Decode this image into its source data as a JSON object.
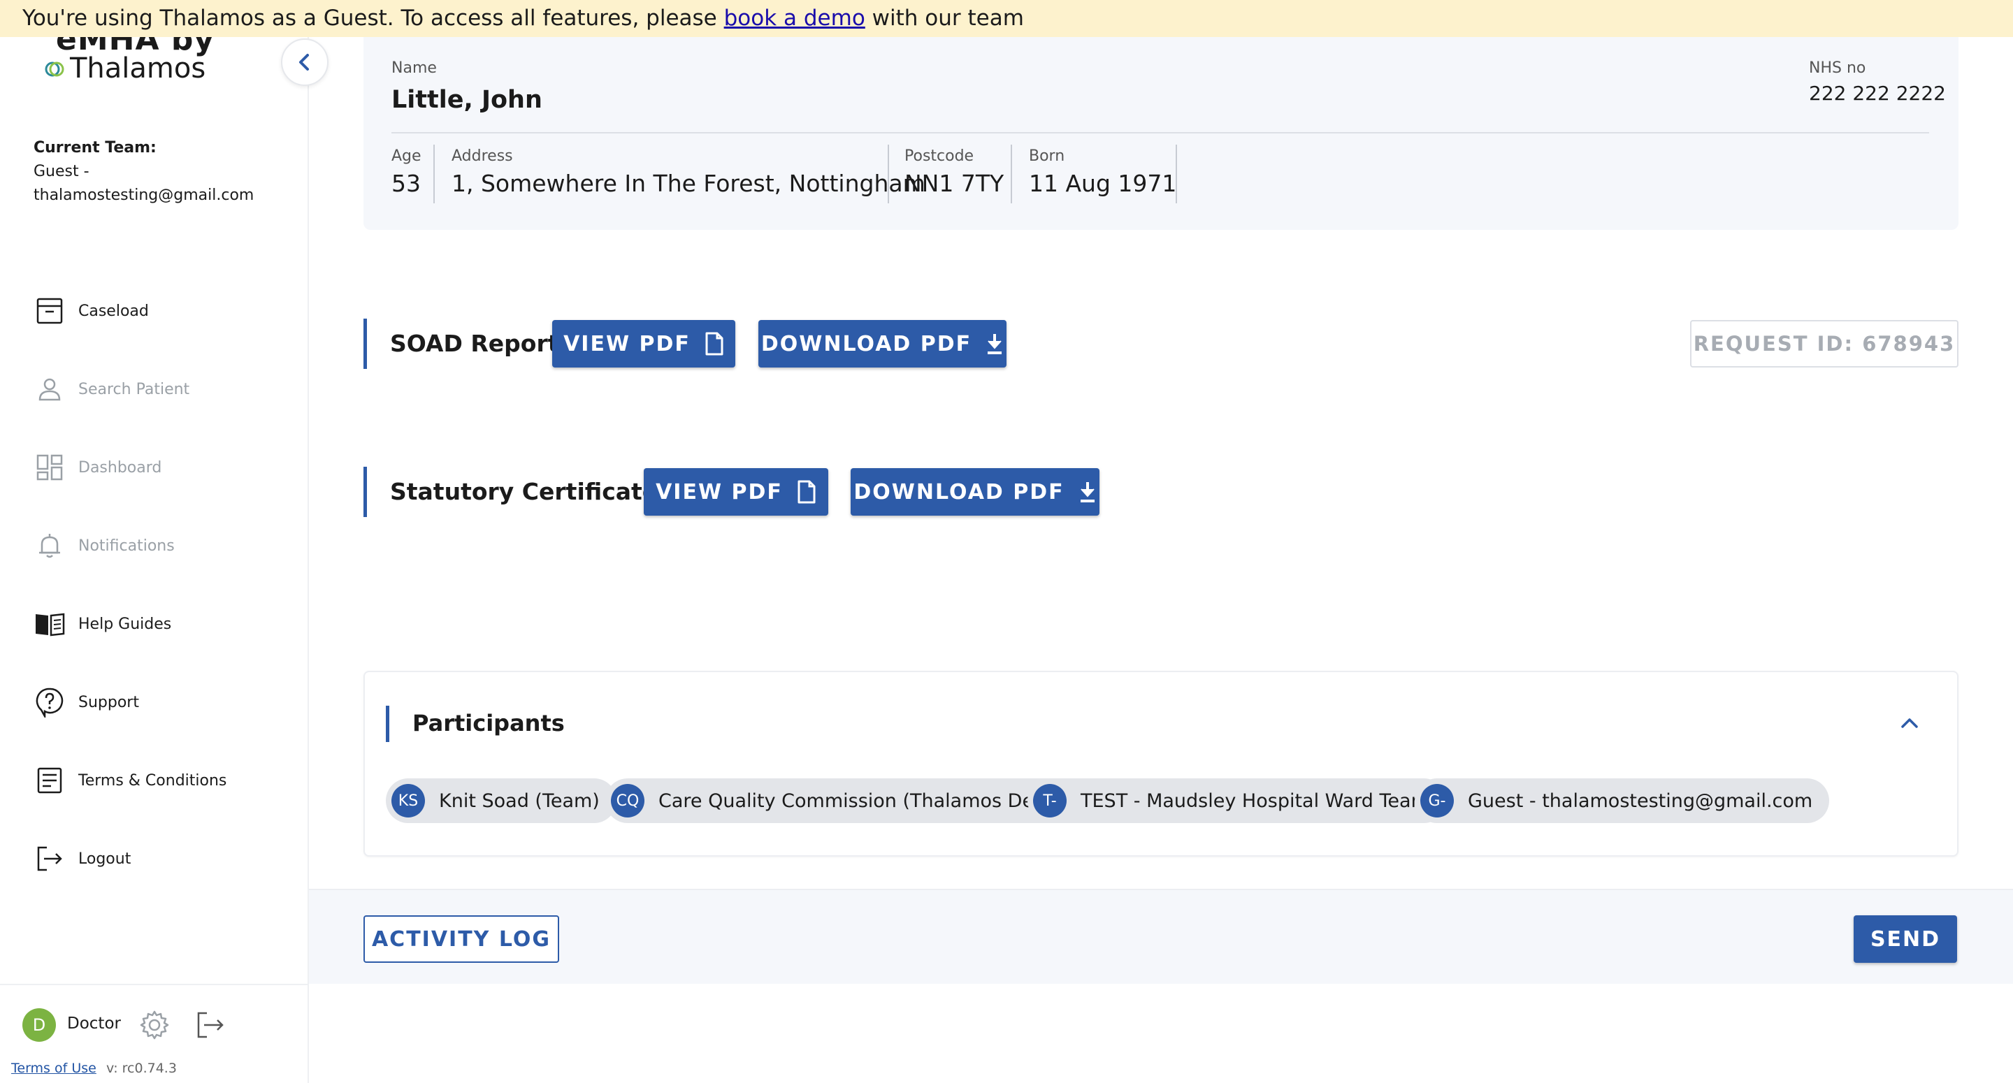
{
  "banner": {
    "text_before": "You're using Thalamos as a Guest. To access all features, please ",
    "link": "book a demo",
    "text_after": " with our team"
  },
  "sidebar": {
    "logo_line1": "eMHA by",
    "logo_line2": "Thalamos",
    "team_label": "Current Team:",
    "team_line1": "Guest -",
    "team_line2": "thalamostesting@gmail.com",
    "items": [
      {
        "label": "Caseload",
        "icon": "archive-box-icon",
        "enabled": true
      },
      {
        "label": "Search Patient",
        "icon": "person-icon",
        "enabled": false
      },
      {
        "label": "Dashboard",
        "icon": "grid-icon",
        "enabled": false
      },
      {
        "label": "Notifications",
        "icon": "bell-icon",
        "enabled": false
      },
      {
        "label": "Help Guides",
        "icon": "open-book-icon",
        "enabled": true
      },
      {
        "label": "Support",
        "icon": "question-bubble-icon",
        "enabled": true
      },
      {
        "label": "Terms & Conditions",
        "icon": "document-list-icon",
        "enabled": true
      },
      {
        "label": "Logout",
        "icon": "logout-icon",
        "enabled": true
      }
    ],
    "user": {
      "initial": "D",
      "role": "Doctor"
    },
    "terms_link": "Terms of Use",
    "version": "v: rc0.74.3"
  },
  "patient": {
    "name_label": "Name",
    "name": "Little, John",
    "nhs_label": "NHS no",
    "nhs": "222 222 2222",
    "age_label": "Age",
    "age": "53",
    "address_label": "Address",
    "address": "1, Somewhere In The Forest, Nottingham",
    "postcode_label": "Postcode",
    "postcode": "NN1 7TY",
    "born_label": "Born",
    "born": "11 Aug 1971"
  },
  "soad": {
    "title": "SOAD Report",
    "view_label": "VIEW PDF",
    "download_label": "DOWNLOAD PDF",
    "request_id": "REQUEST ID: 678943"
  },
  "certificates": {
    "title": "Statutory Certificates",
    "view_label": "VIEW PDF",
    "download_label": "DOWNLOAD PDF"
  },
  "participants": {
    "title": "Participants",
    "chips": [
      {
        "initials": "KS",
        "name": "Knit Soad (Team)"
      },
      {
        "initials": "CQ",
        "name": "Care Quality Commission (Thalamos Dev)"
      },
      {
        "initials": "T-",
        "name": "TEST - Maudsley Hospital Ward Team"
      },
      {
        "initials": "G-",
        "name": "Guest - thalamostesting@gmail.com"
      }
    ]
  },
  "footer": {
    "activity_label": "ACTIVITY LOG",
    "send_label": "SEND"
  },
  "colors": {
    "primary": "#2d5ba8",
    "banner_bg": "#fdf2cd",
    "card_bg": "#f5f7fb",
    "avatar": "#7cb342"
  }
}
